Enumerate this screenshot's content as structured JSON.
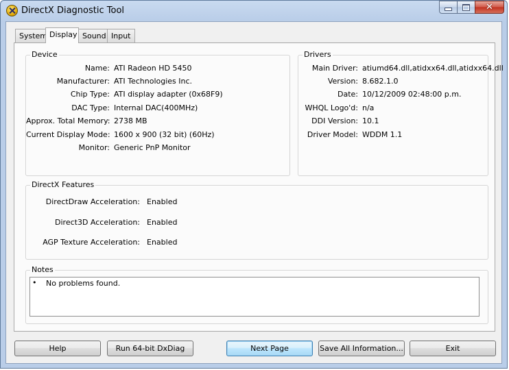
{
  "window": {
    "title": "DirectX Diagnostic Tool",
    "icon": "directx-icon"
  },
  "tabs": [
    {
      "label": "System",
      "active": false
    },
    {
      "label": "Display",
      "active": true
    },
    {
      "label": "Sound",
      "active": false
    },
    {
      "label": "Input",
      "active": false
    }
  ],
  "device": {
    "title": "Device",
    "fields": [
      {
        "label": "Name:",
        "value": "ATI Radeon HD 5450"
      },
      {
        "label": "Manufacturer:",
        "value": "ATI Technologies Inc."
      },
      {
        "label": "Chip Type:",
        "value": "ATI display adapter (0x68F9)"
      },
      {
        "label": "DAC Type:",
        "value": "Internal DAC(400MHz)"
      },
      {
        "label": "Approx. Total Memory:",
        "value": "2738 MB"
      },
      {
        "label": "Current Display Mode:",
        "value": "1600 x 900 (32 bit) (60Hz)"
      },
      {
        "label": "Monitor:",
        "value": "Generic PnP Monitor"
      }
    ]
  },
  "drivers": {
    "title": "Drivers",
    "fields": [
      {
        "label": "Main Driver:",
        "value": "atiumd64.dll,atidxx64.dll,atidxx64.dll"
      },
      {
        "label": "Version:",
        "value": "8.682.1.0"
      },
      {
        "label": "Date:",
        "value": "10/12/2009 02:48:00 p.m."
      },
      {
        "label": "WHQL Logo'd:",
        "value": "n/a"
      },
      {
        "label": "DDI Version:",
        "value": "10.1"
      },
      {
        "label": "Driver Model:",
        "value": "WDDM 1.1"
      }
    ]
  },
  "features": {
    "title": "DirectX Features",
    "fields": [
      {
        "label": "DirectDraw Acceleration:",
        "value": "Enabled"
      },
      {
        "label": "Direct3D Acceleration:",
        "value": "Enabled"
      },
      {
        "label": "AGP Texture Acceleration:",
        "value": "Enabled"
      }
    ]
  },
  "notes": {
    "title": "Notes",
    "bullet": "•",
    "items": [
      "No problems found."
    ]
  },
  "buttons": {
    "help": "Help",
    "run64": "Run 64-bit DxDiag",
    "next": "Next Page",
    "save": "Save All Information...",
    "exit": "Exit"
  }
}
